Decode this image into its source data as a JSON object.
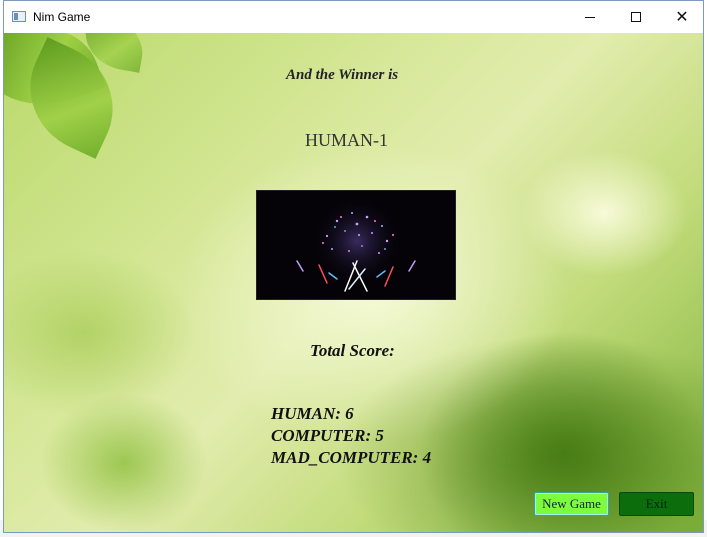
{
  "window": {
    "title": "Nim Game",
    "controls": {
      "minimize": "minimize-icon",
      "maximize": "maximize-icon",
      "close": "close-icon"
    }
  },
  "result": {
    "heading": "And the Winner is",
    "winner": "HUMAN-1"
  },
  "scores": {
    "label": "Total Score:",
    "lines": [
      "HUMAN: 6",
      "COMPUTER: 5",
      "MAD_COMPUTER: 4"
    ]
  },
  "buttons": {
    "new_game": "New Game",
    "exit": "Exit"
  },
  "colors": {
    "new_game_bg": "#7cfc3c",
    "exit_bg": "#0b6d0b",
    "background_tint": "#d7e89a"
  },
  "image": {
    "icon": "fireworks-image"
  }
}
